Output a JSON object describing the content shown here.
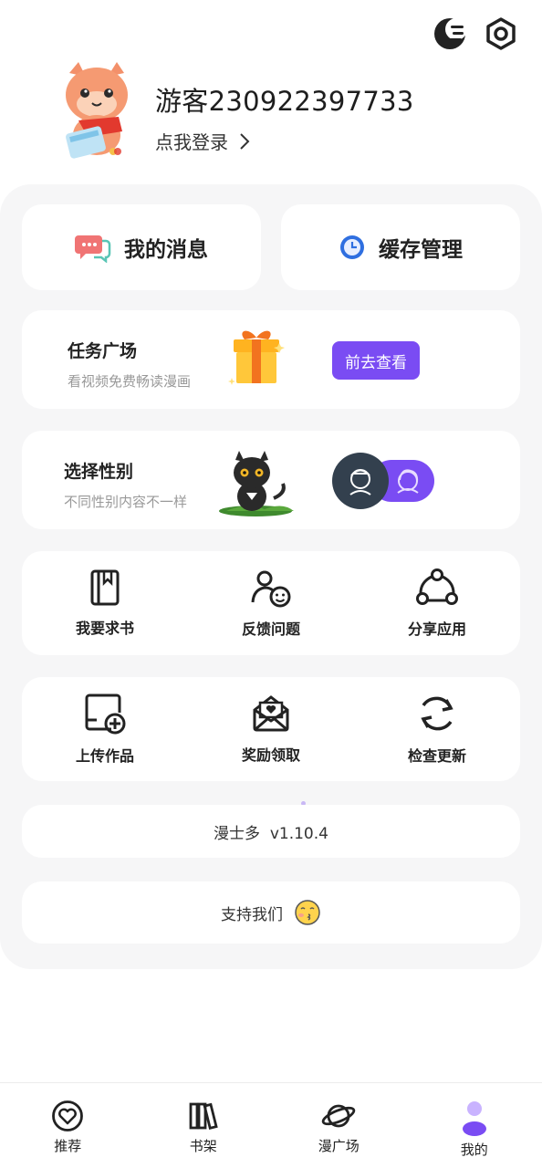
{
  "header": {
    "theme_icon": "night-mode-icon",
    "settings_icon": "settings-hex-icon"
  },
  "profile": {
    "username": "游客230922397733",
    "login_label": "点我登录"
  },
  "quick_actions": [
    {
      "label": "我的消息",
      "icon": "chat-bubble-icon"
    },
    {
      "label": "缓存管理",
      "icon": "clock-icon"
    }
  ],
  "task_card": {
    "title": "任务广场",
    "subtitle": "看视频免费畅读漫画",
    "button_label": "前去查看"
  },
  "gender_card": {
    "title": "选择性别",
    "subtitle": "不同性别内容不一样"
  },
  "grid_row_1": [
    {
      "label": "我要求书",
      "icon": "book-icon"
    },
    {
      "label": "反馈问题",
      "icon": "feedback-icon"
    },
    {
      "label": "分享应用",
      "icon": "share-icon"
    }
  ],
  "grid_row_2": [
    {
      "label": "上传作品",
      "icon": "upload-icon"
    },
    {
      "label": "奖励领取",
      "icon": "reward-envelope-icon"
    },
    {
      "label": "检查更新",
      "icon": "refresh-icon"
    }
  ],
  "version_text": "漫士多  v1.10.4",
  "support_text": "支持我们",
  "bottom_nav": [
    {
      "label": "推荐",
      "icon": "heart-circle-icon"
    },
    {
      "label": "书架",
      "icon": "bookshelf-icon"
    },
    {
      "label": "漫广场",
      "icon": "planet-icon"
    },
    {
      "label": "我的",
      "icon": "user-icon"
    }
  ],
  "colors": {
    "accent": "#7a4cf3",
    "panel_bg": "#f6f6f7"
  }
}
